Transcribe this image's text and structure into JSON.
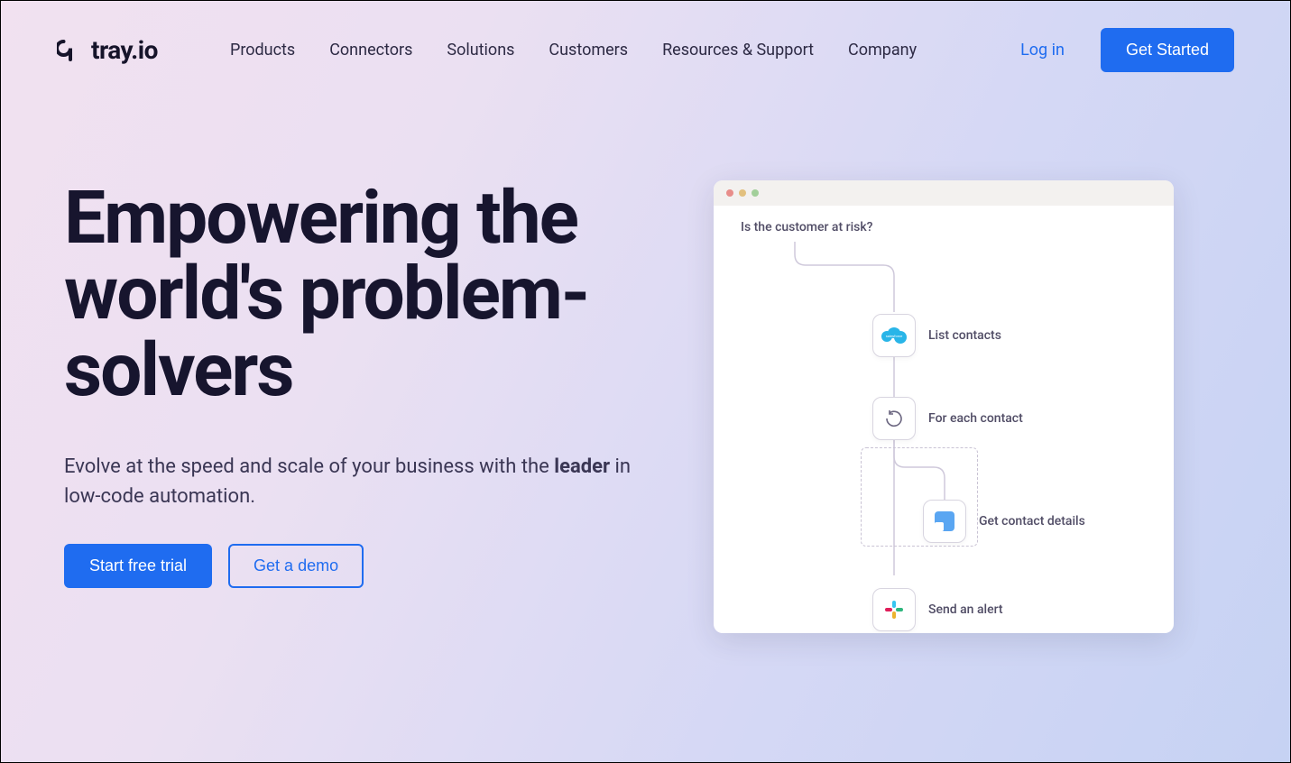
{
  "brand": "tray.io",
  "nav": {
    "items": [
      "Products",
      "Connectors",
      "Solutions",
      "Customers",
      "Resources & Support",
      "Company"
    ]
  },
  "auth": {
    "login": "Log in",
    "get_started": "Get Started"
  },
  "hero": {
    "title": "Empowering the world's problem-solvers",
    "sub_pre": "Evolve at the speed and scale of your business with the ",
    "sub_bold": "leader",
    "sub_post": " in low-code automation.",
    "cta_primary": "Start free trial",
    "cta_secondary": "Get a demo"
  },
  "workflow": {
    "question": "Is the customer at risk?",
    "nodes": [
      {
        "label": "List contacts",
        "icon": "salesforce"
      },
      {
        "label": "For each contact",
        "icon": "loop"
      },
      {
        "label": "Get contact details",
        "icon": "contact"
      },
      {
        "label": "Send an alert",
        "icon": "slack"
      }
    ]
  },
  "colors": {
    "primary_blue": "#1f6cf0",
    "dark_text": "#17152e"
  }
}
